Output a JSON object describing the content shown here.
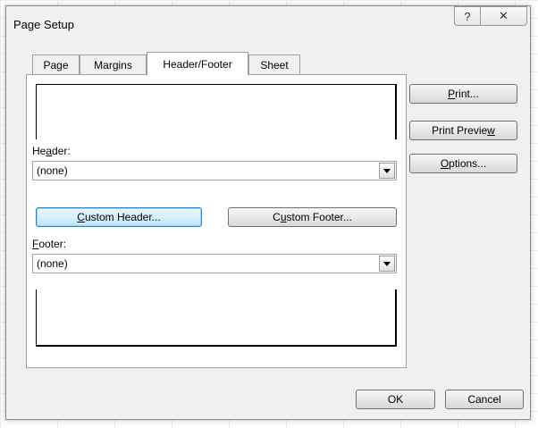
{
  "dialog": {
    "title": "Page Setup",
    "help_glyph": "?",
    "close_glyph": "✕"
  },
  "tabs": [
    {
      "label": "Page",
      "active": false
    },
    {
      "label": "Margins",
      "active": false
    },
    {
      "label": "Header/Footer",
      "active": true
    },
    {
      "label": "Sheet",
      "active": false
    }
  ],
  "header": {
    "label_pre": "He",
    "label_key": "a",
    "label_post": "der:",
    "value": "(none)",
    "custom_button_pre": "",
    "custom_button_key": "C",
    "custom_button_post": "ustom Header..."
  },
  "footer": {
    "label_pre": "",
    "label_key": "F",
    "label_post": "ooter:",
    "value": "(none)",
    "custom_button_pre": "C",
    "custom_button_key": "u",
    "custom_button_post": "stom Footer..."
  },
  "side_buttons": {
    "print_pre": "",
    "print_key": "P",
    "print_post": "rint...",
    "preview_pre": "Print Previe",
    "preview_key": "w",
    "preview_post": "",
    "options_pre": "",
    "options_key": "O",
    "options_post": "ptions..."
  },
  "footer_buttons": {
    "ok": "OK",
    "cancel": "Cancel"
  }
}
